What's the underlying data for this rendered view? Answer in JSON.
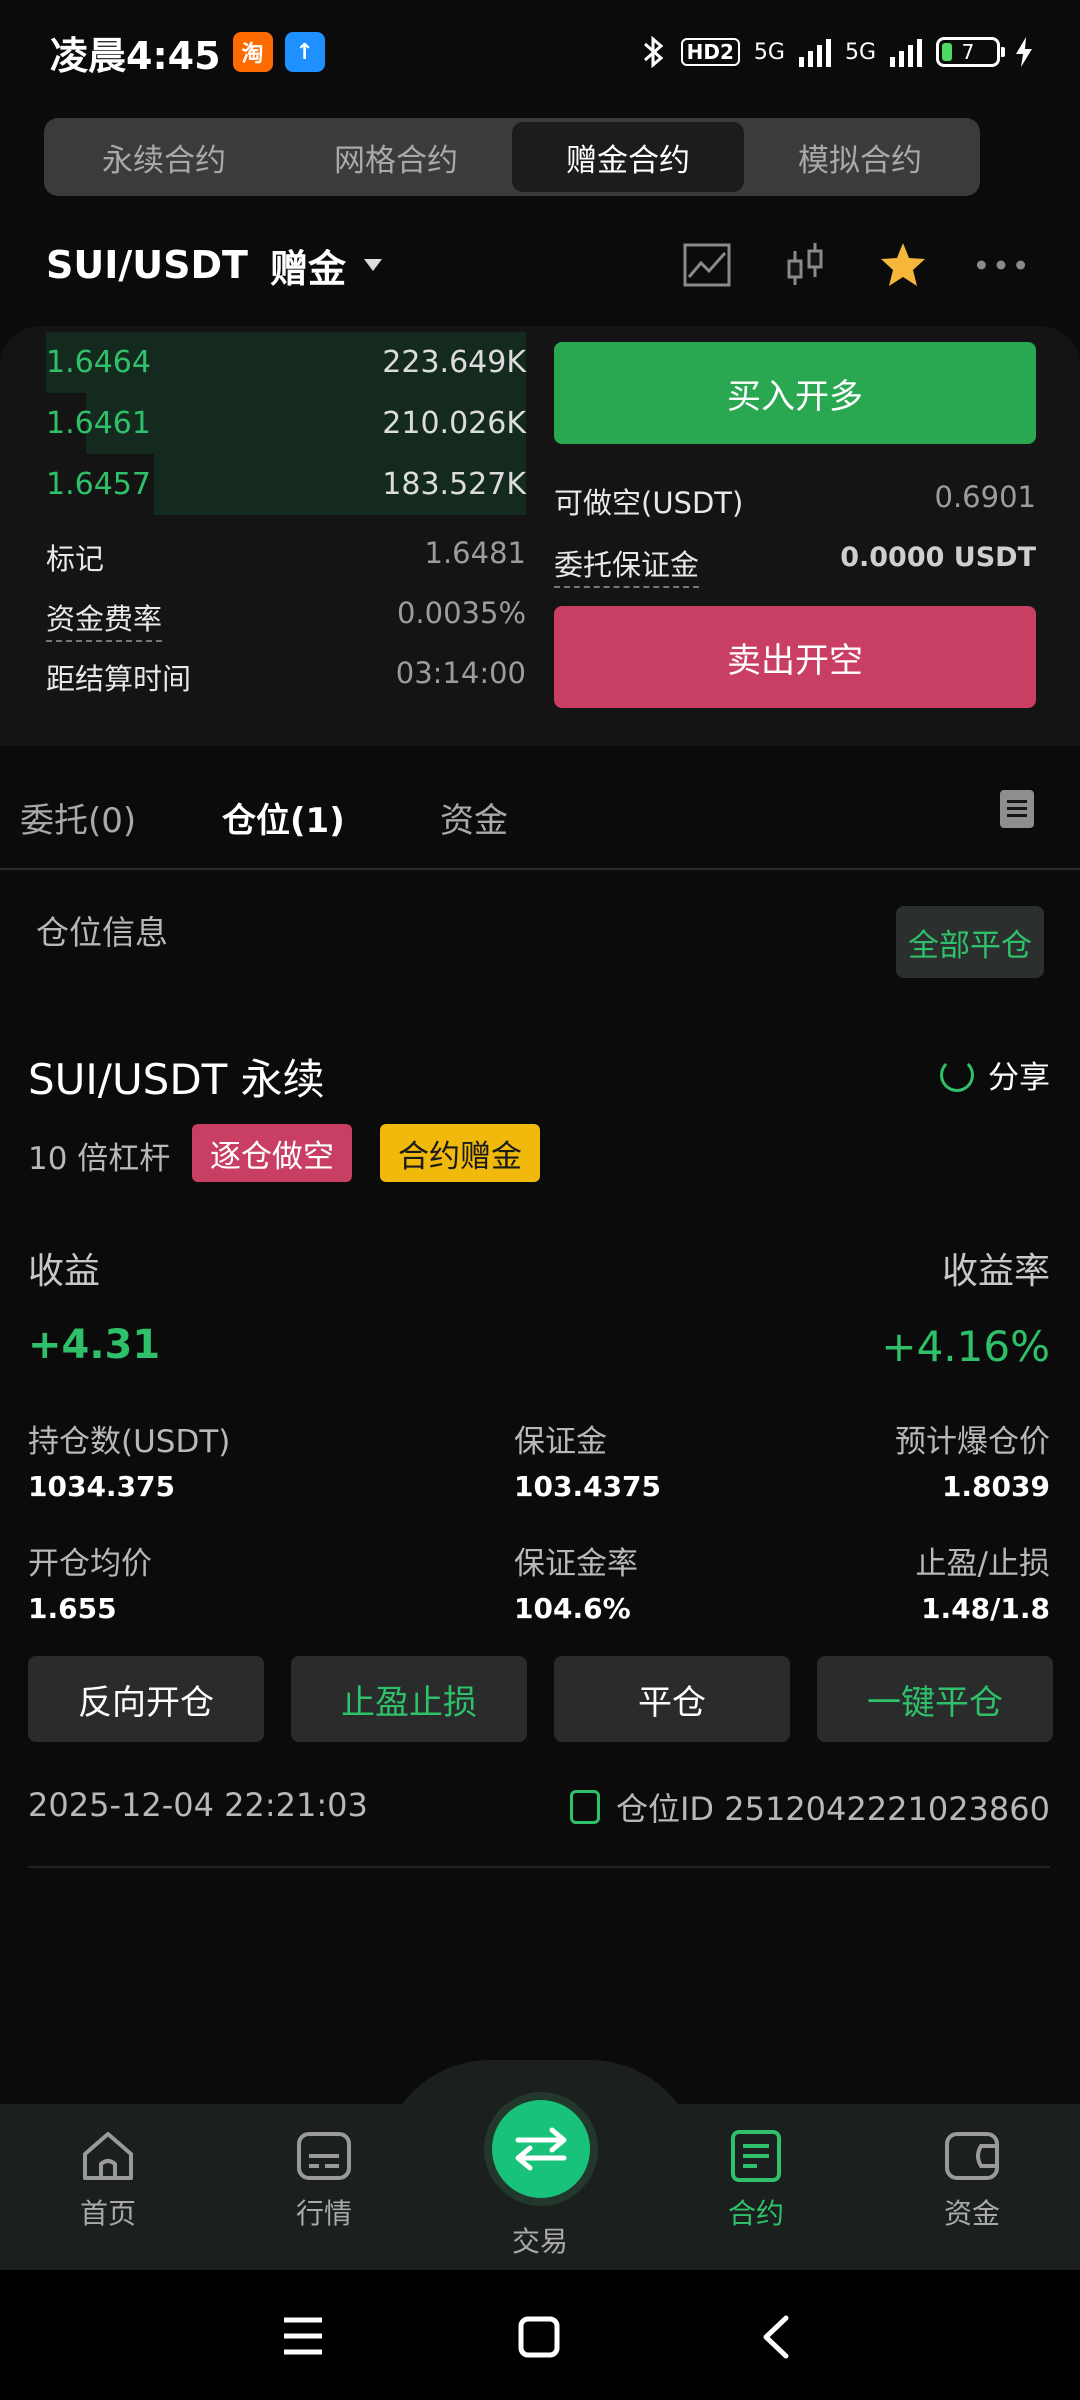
{
  "status": {
    "time": "凌晨4:45",
    "app1": "淘",
    "app2": "↑",
    "hd": "HD2",
    "net1": "5G",
    "net2": "5G",
    "battery": "7"
  },
  "contract_tabs": [
    {
      "label": "永续合约"
    },
    {
      "label": "网格合约"
    },
    {
      "label": "赠金合约"
    },
    {
      "label": "模拟合约"
    }
  ],
  "pair": {
    "name": "SUI/USDT",
    "tag": "赠金"
  },
  "order_book": [
    {
      "price": "1.6464",
      "qty": "223.649K"
    },
    {
      "price": "1.6461",
      "qty": "210.026K"
    },
    {
      "price": "1.6457",
      "qty": "183.527K"
    }
  ],
  "market_info": {
    "mark_label": "标记",
    "mark_value": "1.6481",
    "funding_label": "资金费率",
    "funding_value": "0.0035%",
    "settle_label": "距结算时间",
    "settle_value": "03:14:00"
  },
  "trade": {
    "buy_label": "买入开多",
    "sell_label": "卖出开空",
    "short_avail_label": "可做空(USDT)",
    "short_avail_value": "0.6901",
    "margin_label": "委托保证金",
    "margin_value": "0.0000 USDT"
  },
  "pos_tabs": [
    {
      "label": "委托(0)"
    },
    {
      "label": "仓位(1)"
    },
    {
      "label": "资金"
    }
  ],
  "position": {
    "section_title": "仓位信息",
    "close_all": "全部平仓",
    "symbol": "SUI/USDT 永续",
    "share": "分享",
    "leverage": "10 倍杠杆",
    "badge_mode": "逐仓做空",
    "badge_bonus": "合约赠金",
    "pnl_label": "收益",
    "pnl_value": "+4.31",
    "roi_label": "收益率",
    "roi_value": "+4.16%",
    "size_label": "持仓数(USDT)",
    "size_value": "1034.375",
    "margin_label": "保证金",
    "margin_value": "103.4375",
    "liq_label": "预计爆仓价",
    "liq_value": "1.8039",
    "entry_label": "开仓均价",
    "entry_value": "1.655",
    "margin_ratio_label": "保证金率",
    "margin_ratio_value": "104.6%",
    "tpsl_label": "止盈/止损",
    "tpsl_value": "1.48/1.8",
    "btn_reverse": "反向开仓",
    "btn_tpsl": "止盈止损",
    "btn_close": "平仓",
    "btn_quick_close": "一键平仓",
    "open_time": "2025-12-04 22:21:03",
    "id_text": "仓位ID 2512042221023860"
  },
  "nav": [
    {
      "label": "首页"
    },
    {
      "label": "行情"
    },
    {
      "label": "交易"
    },
    {
      "label": "合约"
    },
    {
      "label": "资金"
    }
  ],
  "colors": {
    "green": "#2ec16a",
    "red": "#c93f63",
    "yellow": "#f0b90b"
  }
}
